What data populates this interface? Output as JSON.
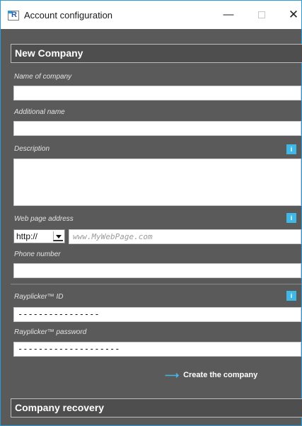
{
  "window": {
    "title": "Account configuration",
    "app_icon_letter": "R",
    "minimize_glyph": "—",
    "close_glyph": "✕"
  },
  "new_company": {
    "header": "New Company",
    "name_label": "Name of company",
    "name_value": "",
    "additional_label": "Additional name",
    "additional_value": "",
    "description_label": "Description",
    "description_value": "",
    "web_label": "Web page address",
    "protocol_selected": "http://",
    "web_placeholder": "www.MyWebPage.com",
    "phone_label": "Phone number",
    "phone_value": "",
    "rayplicker_id_label": "Rayplicker™ ID",
    "rayplicker_id_value": "----------------",
    "rayplicker_password_label": "Rayplicker™ password",
    "rayplicker_password_value": "--------------------",
    "info_glyph": "i",
    "create_button": "Create the company",
    "create_arrow": "⟶"
  },
  "company_recovery": {
    "header": "Company recovery"
  },
  "colors": {
    "background": "#5a5a5a",
    "accent": "#3fb8e6",
    "window_border": "#2d9ad6"
  }
}
